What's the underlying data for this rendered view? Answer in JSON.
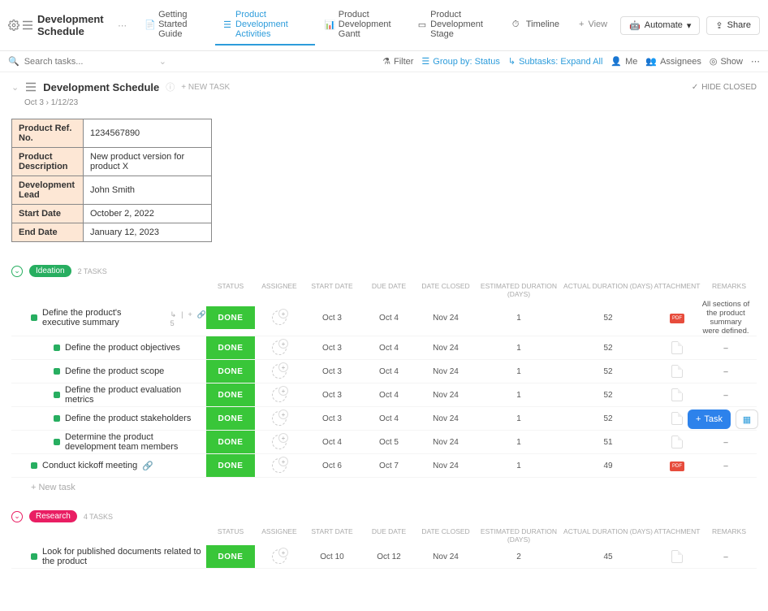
{
  "header": {
    "title": "Development Schedule",
    "tabs": [
      {
        "label": "Getting Started Guide",
        "active": false
      },
      {
        "label": "Product Development Activities",
        "active": true
      },
      {
        "label": "Product Development Gantt",
        "active": false
      },
      {
        "label": "Product Development Stage",
        "active": false
      },
      {
        "label": "Timeline",
        "active": false
      }
    ],
    "add_view": "View",
    "automate": "Automate",
    "share": "Share"
  },
  "filterbar": {
    "search_placeholder": "Search tasks...",
    "filter": "Filter",
    "group_by": "Group by: Status",
    "subtasks": "Subtasks: Expand All",
    "me": "Me",
    "assignees": "Assignees",
    "show": "Show"
  },
  "list": {
    "title": "Development Schedule",
    "new_task": "+ NEW TASK",
    "hide_closed": "HIDE CLOSED",
    "date_range": "Oct 3  ›  1/12/23"
  },
  "meta": [
    {
      "k": "Product Ref. No.",
      "v": "1234567890"
    },
    {
      "k": "Product Description",
      "v": "New product version for product X"
    },
    {
      "k": "Development Lead",
      "v": "John Smith"
    },
    {
      "k": "Start Date",
      "v": "October 2, 2022"
    },
    {
      "k": "End Date",
      "v": "January 12, 2023"
    }
  ],
  "columns": [
    "",
    "STATUS",
    "ASSIGNEE",
    "START DATE",
    "DUE DATE",
    "DATE CLOSED",
    "ESTIMATED DURATION (DAYS)",
    "ACTUAL DURATION (DAYS)",
    "ATTACHMENT",
    "REMARKS"
  ],
  "sections": [
    {
      "name": "Ideation",
      "chip_class": "ideation",
      "collapse_class": "green",
      "count": "2 TASKS",
      "tasks": [
        {
          "name": "Define the product's executive summary",
          "sub": false,
          "status": "DONE",
          "start": "Oct 3",
          "due": "Oct 4",
          "closed": "Nov 24",
          "est": "1",
          "act": "52",
          "att": "pdf",
          "remarks": "All sections of the product summary were defined.",
          "has_sub": true
        },
        {
          "name": "Define the product objectives",
          "sub": true,
          "status": "DONE",
          "start": "Oct 3",
          "due": "Oct 4",
          "closed": "Nov 24",
          "est": "1",
          "act": "52",
          "att": "doc",
          "remarks": "–"
        },
        {
          "name": "Define the product scope",
          "sub": true,
          "status": "DONE",
          "start": "Oct 3",
          "due": "Oct 4",
          "closed": "Nov 24",
          "est": "1",
          "act": "52",
          "att": "doc",
          "remarks": "–"
        },
        {
          "name": "Define the product evaluation metrics",
          "sub": true,
          "status": "DONE",
          "start": "Oct 3",
          "due": "Oct 4",
          "closed": "Nov 24",
          "est": "1",
          "act": "52",
          "att": "doc",
          "remarks": "–"
        },
        {
          "name": "Define the product stakeholders",
          "sub": true,
          "status": "DONE",
          "start": "Oct 3",
          "due": "Oct 4",
          "closed": "Nov 24",
          "est": "1",
          "act": "52",
          "att": "doc",
          "remarks": "–"
        },
        {
          "name": "Determine the product development team members",
          "sub": true,
          "status": "DONE",
          "start": "Oct 4",
          "due": "Oct 5",
          "closed": "Nov 24",
          "est": "1",
          "act": "51",
          "att": "doc",
          "remarks": "–"
        },
        {
          "name": "Conduct kickoff meeting",
          "sub": false,
          "status": "DONE",
          "start": "Oct 6",
          "due": "Oct 7",
          "closed": "Nov 24",
          "est": "1",
          "act": "49",
          "att": "pdf",
          "remarks": "–",
          "link": true
        }
      ],
      "new_task": "+ New task"
    },
    {
      "name": "Research",
      "chip_class": "research",
      "collapse_class": "pink",
      "count": "4 TASKS",
      "tasks": [
        {
          "name": "Look for published documents related to the product",
          "sub": false,
          "status": "DONE",
          "start": "Oct 10",
          "due": "Oct 12",
          "closed": "Nov 24",
          "est": "2",
          "act": "45",
          "att": "doc",
          "remarks": "–"
        }
      ]
    }
  ],
  "fab": {
    "label": "Task"
  }
}
